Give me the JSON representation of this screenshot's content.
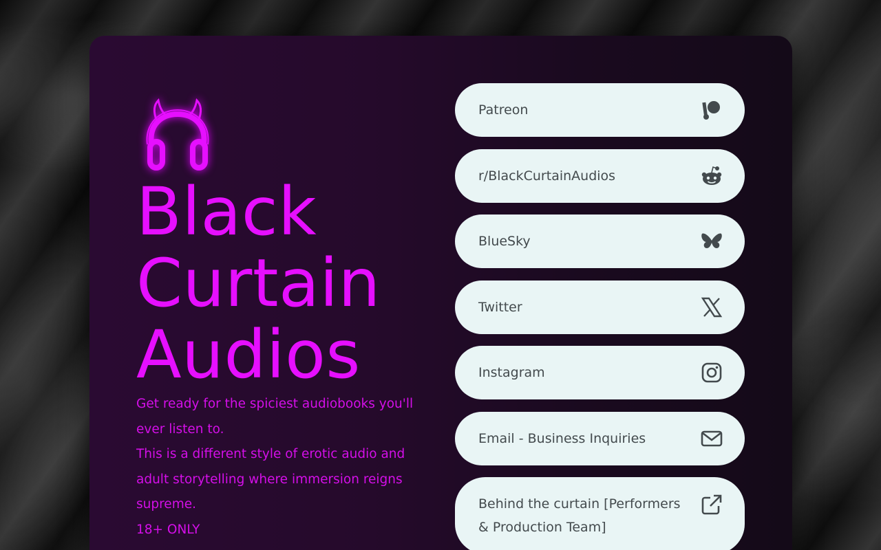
{
  "brand": {
    "title_lines": [
      "Black",
      "Curtain",
      "Audios"
    ],
    "logo_icon": "devil-headphones-icon",
    "accent_color": "#e60fff"
  },
  "description": {
    "lines": [
      "Get ready for the spiciest audiobooks you'll ever listen to.",
      "This is a different style of erotic audio and adult storytelling where immersion reigns supreme.",
      "18+ ONLY"
    ]
  },
  "links": [
    {
      "label": "Patreon",
      "icon": "patreon-icon"
    },
    {
      "label": "r/BlackCurtainAudios",
      "icon": "reddit-icon"
    },
    {
      "label": "BlueSky",
      "icon": "bluesky-butterfly-icon"
    },
    {
      "label": "Twitter",
      "icon": "x-twitter-icon"
    },
    {
      "label": "Instagram",
      "icon": "instagram-icon"
    },
    {
      "label": "Email - Business Inquiries",
      "icon": "mail-icon"
    },
    {
      "label": "Behind the curtain [Performers & Production Team]",
      "icon": "external-link-icon"
    }
  ]
}
